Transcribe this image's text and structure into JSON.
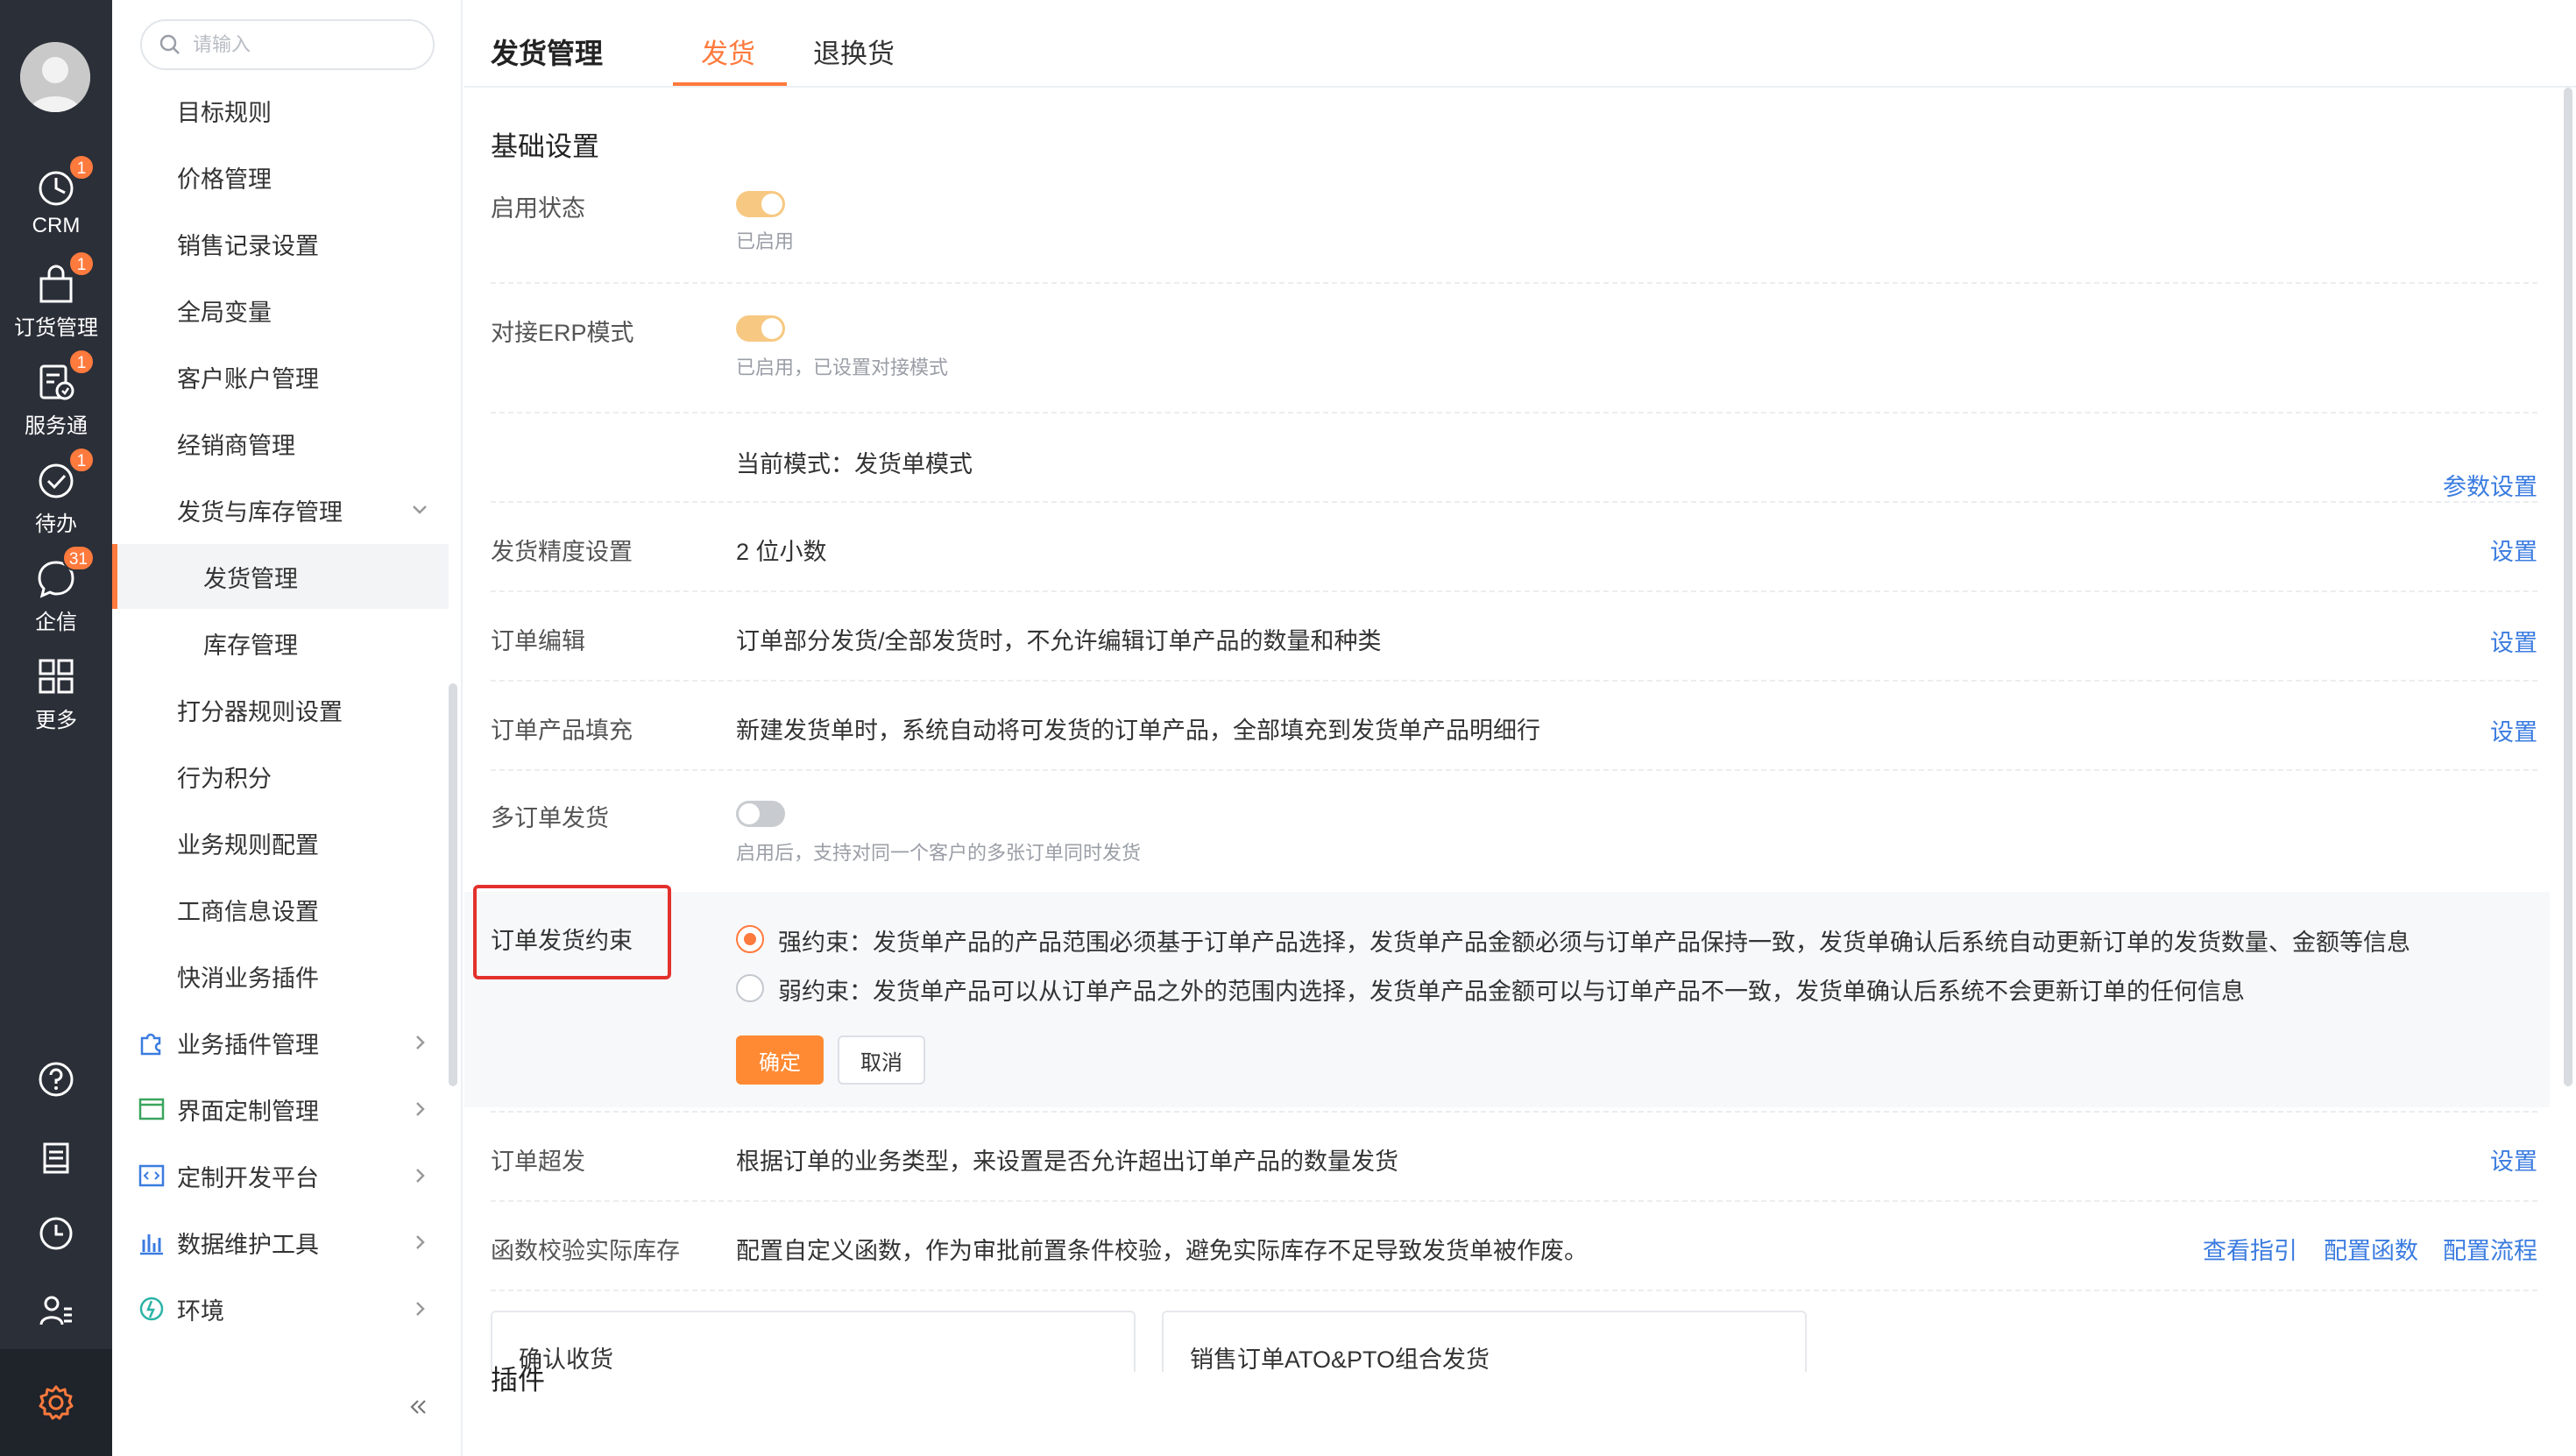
{
  "rail": {
    "items": [
      {
        "label": "CRM",
        "badge": "1",
        "icon": "crm-clock-icon"
      },
      {
        "label": "订货管理",
        "badge": "1",
        "icon": "shopping-bag-icon"
      },
      {
        "label": "服务通",
        "badge": "1",
        "icon": "service-icon"
      },
      {
        "label": "待办",
        "badge": "1",
        "icon": "check-circle-icon"
      },
      {
        "label": "企信",
        "badge": "31",
        "icon": "chat-bubble-icon"
      },
      {
        "label": "更多",
        "badge": "",
        "icon": "grid-icon"
      }
    ]
  },
  "sidebar": {
    "search_placeholder": "请输入",
    "items": [
      {
        "label": "目标规则"
      },
      {
        "label": "价格管理"
      },
      {
        "label": "销售记录设置"
      },
      {
        "label": "全局变量"
      },
      {
        "label": "客户账户管理"
      },
      {
        "label": "经销商管理"
      },
      {
        "label": "发货与库存管理"
      },
      {
        "label": "发货管理"
      },
      {
        "label": "库存管理"
      },
      {
        "label": "打分器规则设置"
      },
      {
        "label": "行为积分"
      },
      {
        "label": "业务规则配置"
      },
      {
        "label": "工商信息设置"
      },
      {
        "label": "快消业务插件"
      },
      {
        "label": "业务插件管理"
      },
      {
        "label": "界面定制管理"
      },
      {
        "label": "定制开发平台"
      },
      {
        "label": "数据维护工具"
      },
      {
        "label": "环境"
      }
    ]
  },
  "header": {
    "title": "发货管理",
    "tabs": [
      {
        "label": "发货"
      },
      {
        "label": "退换货"
      }
    ]
  },
  "content": {
    "basic_title": "基础设置",
    "enable_status": {
      "label": "启用状态",
      "sub": "已启用"
    },
    "erp_mode": {
      "label": "对接ERP模式",
      "sub": "已启用，已设置对接模式",
      "current": "当前模式：发货单模式",
      "link": "参数设置"
    },
    "precision": {
      "label": "发货精度设置",
      "value": "2 位小数",
      "link": "设置"
    },
    "order_edit": {
      "label": "订单编辑",
      "value": "订单部分发货/全部发货时，不允许编辑订单产品的数量和种类",
      "link": "设置"
    },
    "order_fill": {
      "label": "订单产品填充",
      "value": "新建发货单时，系统自动将可发货的订单产品，全部填充到发货单产品明细行",
      "link": "设置"
    },
    "multi_order": {
      "label": "多订单发货",
      "sub": "启用后，支持对同一个客户的多张订单同时发货"
    },
    "constraint": {
      "label": "订单发货约束",
      "strong": "强约束：发货单产品的产品范围必须基于订单产品选择，发货单产品金额必须与订单产品保持一致，发货单确认后系统自动更新订单的发货数量、金额等信息",
      "weak": "弱约束：发货单产品可以从订单产品之外的范围内选择，发货单产品金额可以与订单产品不一致，发货单确认后系统不会更新订单的任何信息",
      "confirm": "确定",
      "cancel": "取消"
    },
    "over_ship": {
      "label": "订单超发",
      "value": "根据订单的业务类型，来设置是否允许超出订单产品的数量发货",
      "link": "设置"
    },
    "func_check": {
      "label": "函数校验实际库存",
      "value": "配置自定义函数，作为审批前置条件校验，避免实际库存不足导致发货单被作废。",
      "links": [
        "查看指引",
        "配置函数",
        "配置流程"
      ]
    },
    "plugins_title": "插件",
    "plugin_cards": [
      "确认收货",
      "销售订单ATO&PTO组合发货"
    ]
  },
  "colors": {
    "accent": "#ff7a3d",
    "link": "#3b7ce0",
    "rail": "#2b2f38",
    "highlight": "#e3312d"
  }
}
